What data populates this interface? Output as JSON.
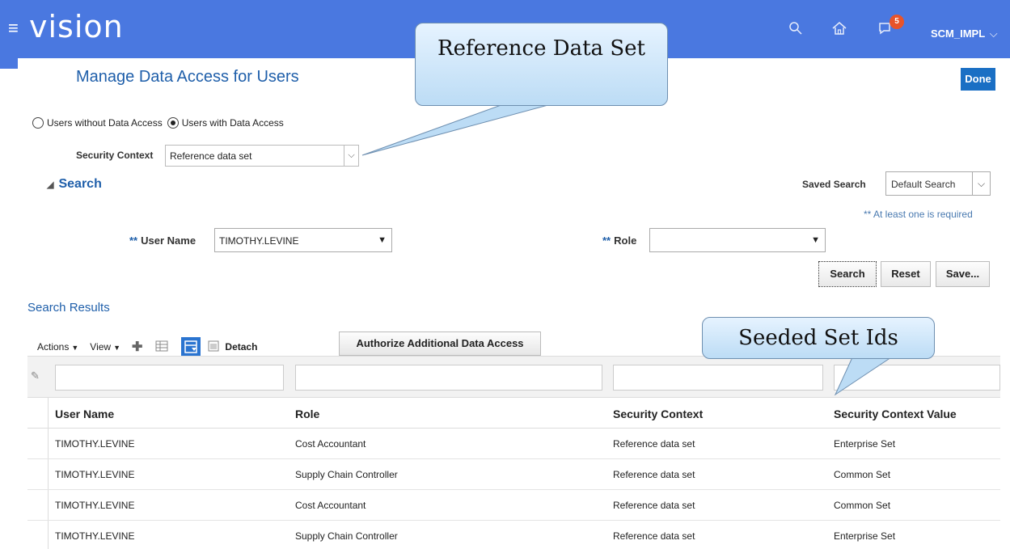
{
  "header": {
    "logo": "vision",
    "notification_count": "5",
    "user": "SCM_IMPL"
  },
  "page": {
    "title": "Manage Data Access for Users",
    "done_label": "Done"
  },
  "filter_mode": {
    "option_without": "Users without Data Access",
    "option_with": "Users with Data Access",
    "selected": "Users with Data Access"
  },
  "security_context": {
    "label": "Security Context",
    "value": "Reference data set"
  },
  "search": {
    "title": "Search",
    "saved_search_label": "Saved Search",
    "saved_search_value": "Default Search",
    "required_note": "** At least one is required",
    "user_name_label": "User Name",
    "user_name_value": "TIMOTHY.LEVINE",
    "role_label": "Role",
    "role_value": "",
    "required_mark": "**",
    "search_btn": "Search",
    "reset_btn": "Reset",
    "save_btn": "Save..."
  },
  "results": {
    "title": "Search Results",
    "actions_label": "Actions",
    "view_label": "View",
    "detach_label": "Detach",
    "authorize_label": "Authorize Additional Data Access",
    "columns": [
      "User Name",
      "Role",
      "Security Context",
      "Security Context Value"
    ],
    "rows": [
      [
        "TIMOTHY.LEVINE",
        "Cost Accountant",
        "Reference data set",
        "Enterprise Set"
      ],
      [
        "TIMOTHY.LEVINE",
        "Supply Chain Controller",
        "Reference data set",
        "Common Set"
      ],
      [
        "TIMOTHY.LEVINE",
        "Cost Accountant",
        "Reference data set",
        "Common Set"
      ],
      [
        "TIMOTHY.LEVINE",
        "Supply Chain Controller",
        "Reference data set",
        "Enterprise Set"
      ]
    ]
  },
  "callouts": {
    "reference": "Reference Data Set",
    "seeded": "Seeded Set Ids"
  },
  "colors": {
    "header_bg": "#4a78e0",
    "title_blue": "#1f5faa",
    "done_bg": "#1a6fc4",
    "badge": "#e8542a"
  }
}
